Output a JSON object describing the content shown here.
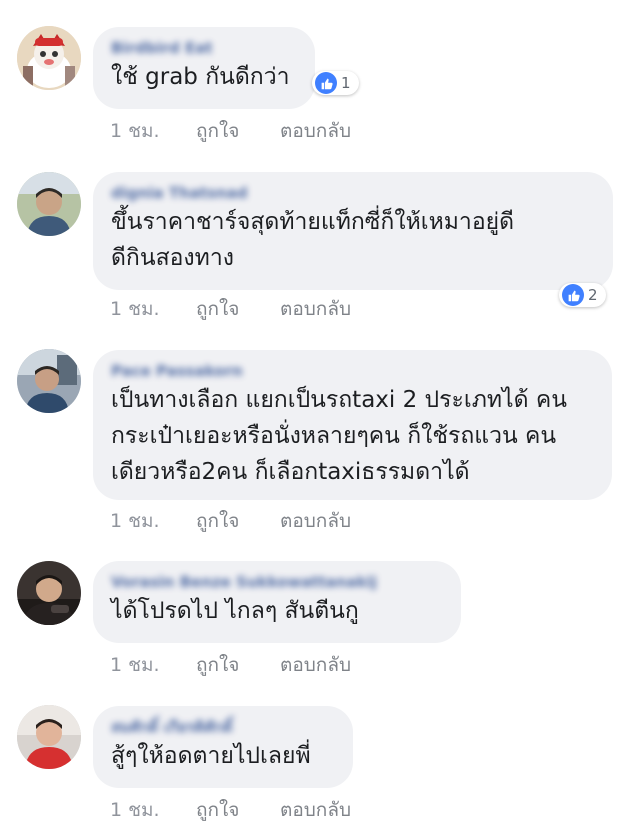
{
  "accent_color": "#4080ff",
  "comments": [
    {
      "name": "Birdbird Eat",
      "text": "ใช้ grab กันดีกว่า",
      "time": "1 ชม.",
      "like_label": "ถูกใจ",
      "reply_label": "ตอบกลับ",
      "reaction_count": "1"
    },
    {
      "name": "dignia Thatsnad",
      "text": "ขึ้นราคาชาร์จสุดท้ายแท็กซี่ก็ให้เหมาอยู่ดี\nดีกินสองทาง",
      "time": "1 ชม.",
      "like_label": "ถูกใจ",
      "reply_label": "ตอบกลับ",
      "reaction_count": "2"
    },
    {
      "name": "Pace Passakorn",
      "text": "เป็นทางเลือก แยกเป็นรถtaxi 2 ประเภทได้ คน\nกระเป๋าเยอะหรือนั่งหลายๆคน ก็ใช้รถแวน คน\nเดียวหรือ2คน ก็เลือกtaxiธรรมดาได้",
      "time": "1 ชม.",
      "like_label": "ถูกใจ",
      "reply_label": "ตอบกลับ"
    },
    {
      "name": "Vorasin Benze Sukkowattanakij",
      "text": "ได้โปรดไป ไกลๆ สันตีนกู",
      "time": "1 ชม.",
      "like_label": "ถูกใจ",
      "reply_label": "ตอบกลับ"
    },
    {
      "name": "สมศักดิ์ เกียรติศักดิ์",
      "text": "สู้ๆให้อดตายไปเลยพี่",
      "time": "1 ชม.",
      "like_label": "ถูกใจ",
      "reply_label": "ตอบกลับ"
    }
  ]
}
